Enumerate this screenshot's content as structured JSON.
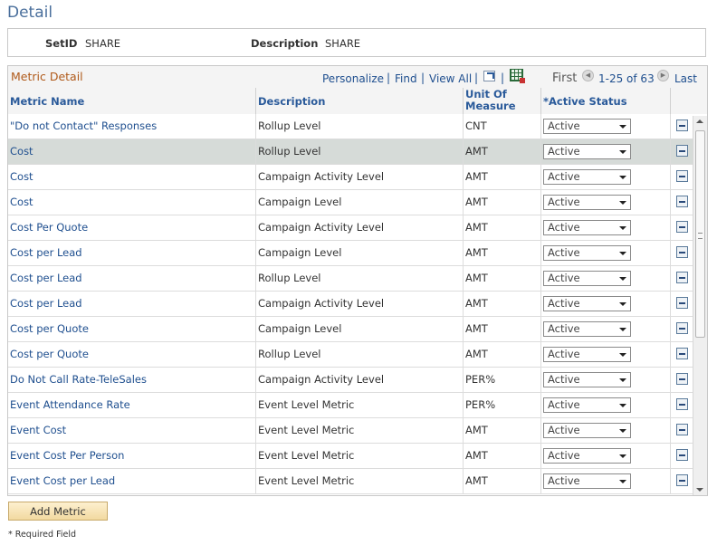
{
  "page": {
    "title": "Detail"
  },
  "info": {
    "setid_label": "SetID",
    "setid_value": "SHARE",
    "description_label": "Description",
    "description_value": "SHARE"
  },
  "grid": {
    "title": "Metric Detail",
    "nav": {
      "personalize": "Personalize",
      "find": "Find",
      "view_all": "View All",
      "separator": "|",
      "first": "First",
      "range": "1-25 of 63",
      "last": "Last",
      "prev_icon": "◀",
      "next_icon": "▶"
    },
    "columns": {
      "name": "Metric Name",
      "description": "Description",
      "uom_line1": "Unit Of",
      "uom_line2": "Measure",
      "status": "*Active Status"
    },
    "rows": [
      {
        "name": "\"Do not Contact\" Responses",
        "description": "Rollup Level",
        "uom": "CNT",
        "status": "Active"
      },
      {
        "name": "Cost",
        "description": "Rollup Level",
        "uom": "AMT",
        "status": "Active"
      },
      {
        "name": "Cost",
        "description": "Campaign Activity Level",
        "uom": "AMT",
        "status": "Active"
      },
      {
        "name": "Cost",
        "description": "Campaign Level",
        "uom": "AMT",
        "status": "Active"
      },
      {
        "name": "Cost Per Quote",
        "description": "Campaign Activity Level",
        "uom": "AMT",
        "status": "Active"
      },
      {
        "name": "Cost per Lead",
        "description": "Campaign Level",
        "uom": "AMT",
        "status": "Active"
      },
      {
        "name": "Cost per Lead",
        "description": "Rollup Level",
        "uom": "AMT",
        "status": "Active"
      },
      {
        "name": "Cost per Lead",
        "description": "Campaign Activity Level",
        "uom": "AMT",
        "status": "Active"
      },
      {
        "name": "Cost per Quote",
        "description": "Campaign Level",
        "uom": "AMT",
        "status": "Active"
      },
      {
        "name": "Cost per Quote",
        "description": "Rollup Level",
        "uom": "AMT",
        "status": "Active"
      },
      {
        "name": "Do Not Call Rate-TeleSales",
        "description": "Campaign Activity Level",
        "uom": "PER%",
        "status": "Active"
      },
      {
        "name": "Event Attendance Rate",
        "description": "Event Level Metric",
        "uom": "PER%",
        "status": "Active"
      },
      {
        "name": "Event Cost",
        "description": "Event Level Metric",
        "uom": "AMT",
        "status": "Active"
      },
      {
        "name": "Event Cost Per Person",
        "description": "Event Level Metric",
        "uom": "AMT",
        "status": "Active"
      },
      {
        "name": "Event Cost per Lead",
        "description": "Event Level Metric",
        "uom": "AMT",
        "status": "Active"
      }
    ],
    "selected_row": 1
  },
  "footer": {
    "add_button": "Add Metric",
    "required_note": "* Required Field"
  },
  "colors": {
    "link": "#1f4f8f",
    "title": "#4a6f9c",
    "grid_title": "#b05a1a",
    "selected_row": "#d6dbd8"
  }
}
